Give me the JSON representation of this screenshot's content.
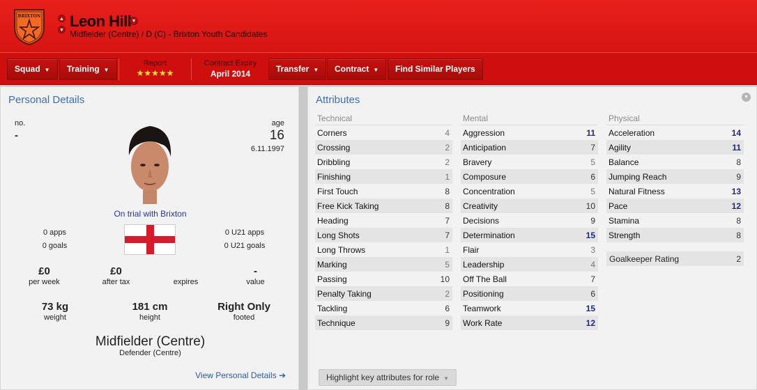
{
  "header": {
    "crest_text_top": "BRIXTON",
    "crest_text_bottom": "FC",
    "player_name": "Leon Hill",
    "subtitle": "Midfielder (Centre) / D (C) - Brixton Youth Candidates"
  },
  "toolbar": {
    "squad": "Squad",
    "training": "Training",
    "report_label": "Report",
    "report_stars": "★★★★★",
    "contract_label": "Contract Expiry",
    "contract_value": "April 2014",
    "transfer": "Transfer",
    "contract": "Contract",
    "find_similar": "Find Similar Players"
  },
  "personal": {
    "title": "Personal Details",
    "no_label": "no.",
    "no_value": "-",
    "age_label": "age",
    "age_value": "16",
    "dob": "6.11.1997",
    "trial": "On trial with Brixton",
    "apps": "0 apps",
    "goals": "0 goals",
    "u21_apps": "0 U21 apps",
    "u21_goals": "0 U21 goals",
    "wage": "£0",
    "wage_label": "per week",
    "after_tax": "£0",
    "after_tax_label": "after tax",
    "expires_label": "expires",
    "value": "-",
    "value_label": "value",
    "weight": "73 kg",
    "weight_label": "weight",
    "height": "181 cm",
    "height_label": "height",
    "footed": "Right Only",
    "footed_label": "footed",
    "position": "Midfielder (Centre)",
    "position_sub": "Defender (Centre)",
    "view_link": "View Personal Details ➔"
  },
  "attributes": {
    "title": "Attributes",
    "technical": {
      "header": "Technical",
      "rows": [
        {
          "name": "Corners",
          "value": "4"
        },
        {
          "name": "Crossing",
          "value": "2"
        },
        {
          "name": "Dribbling",
          "value": "2"
        },
        {
          "name": "Finishing",
          "value": "1"
        },
        {
          "name": "First Touch",
          "value": "8"
        },
        {
          "name": "Free Kick Taking",
          "value": "8"
        },
        {
          "name": "Heading",
          "value": "7"
        },
        {
          "name": "Long Shots",
          "value": "7"
        },
        {
          "name": "Long Throws",
          "value": "1"
        },
        {
          "name": "Marking",
          "value": "5"
        },
        {
          "name": "Passing",
          "value": "10"
        },
        {
          "name": "Penalty Taking",
          "value": "2"
        },
        {
          "name": "Tackling",
          "value": "6"
        },
        {
          "name": "Technique",
          "value": "9"
        }
      ]
    },
    "mental": {
      "header": "Mental",
      "rows": [
        {
          "name": "Aggression",
          "value": "11"
        },
        {
          "name": "Anticipation",
          "value": "7"
        },
        {
          "name": "Bravery",
          "value": "5"
        },
        {
          "name": "Composure",
          "value": "6"
        },
        {
          "name": "Concentration",
          "value": "5"
        },
        {
          "name": "Creativity",
          "value": "10"
        },
        {
          "name": "Decisions",
          "value": "9"
        },
        {
          "name": "Determination",
          "value": "15"
        },
        {
          "name": "Flair",
          "value": "3"
        },
        {
          "name": "Leadership",
          "value": "4"
        },
        {
          "name": "Off The Ball",
          "value": "7"
        },
        {
          "name": "Positioning",
          "value": "6"
        },
        {
          "name": "Teamwork",
          "value": "15"
        },
        {
          "name": "Work Rate",
          "value": "12"
        }
      ]
    },
    "physical": {
      "header": "Physical",
      "rows": [
        {
          "name": "Acceleration",
          "value": "14"
        },
        {
          "name": "Agility",
          "value": "11"
        },
        {
          "name": "Balance",
          "value": "8"
        },
        {
          "name": "Jumping Reach",
          "value": "9"
        },
        {
          "name": "Natural Fitness",
          "value": "13"
        },
        {
          "name": "Pace",
          "value": "12"
        },
        {
          "name": "Stamina",
          "value": "8"
        },
        {
          "name": "Strength",
          "value": "8"
        }
      ]
    },
    "gk_label": "Goalkeeper Rating",
    "gk_value": "2",
    "highlight_button": "Highlight key attributes for role"
  },
  "colors": {
    "header_red": "#e01b18",
    "link_blue": "#3d6eb0",
    "high_value": "#1e2a7a"
  }
}
